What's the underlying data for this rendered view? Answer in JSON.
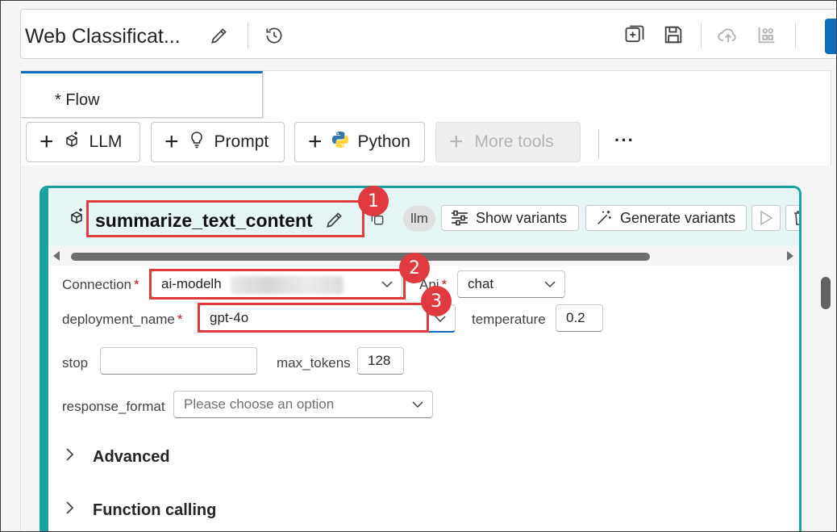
{
  "header": {
    "title": "Web Classificat...",
    "icons": [
      "pencil-icon",
      "history-icon",
      "add-node-icon",
      "save-icon",
      "cloud-upload-icon",
      "layout-icon"
    ]
  },
  "tabs": [
    {
      "label": "* Flow"
    }
  ],
  "toolbar": {
    "llm_label": "LLM",
    "prompt_label": "Prompt",
    "python_label": "Python",
    "more_tools_label": "More tools",
    "overflow_label": "···"
  },
  "node": {
    "name": "summarize_text_content",
    "type_badge": "llm",
    "show_variants_label": "Show variants",
    "generate_variants_label": "Generate variants",
    "fields": {
      "connection": {
        "label": "Connection",
        "value": "ai-modelh"
      },
      "api": {
        "label": "Api",
        "value": "chat"
      },
      "deployment_name": {
        "label": "deployment_name",
        "value": "gpt-4o"
      },
      "temperature": {
        "label": "temperature",
        "value": "0.2"
      },
      "stop": {
        "label": "stop",
        "value": ""
      },
      "max_tokens": {
        "label": "max_tokens",
        "value": "128"
      },
      "response_format": {
        "label": "response_format",
        "placeholder": "Please choose an option"
      }
    },
    "sections": {
      "advanced": "Advanced",
      "function_calling": "Function calling"
    },
    "required_mark": "*"
  },
  "callouts": [
    "1",
    "2",
    "3"
  ],
  "colors": {
    "accent": "#1aa0a0",
    "brand": "#0f6cbd",
    "callout": "#e0393e"
  }
}
